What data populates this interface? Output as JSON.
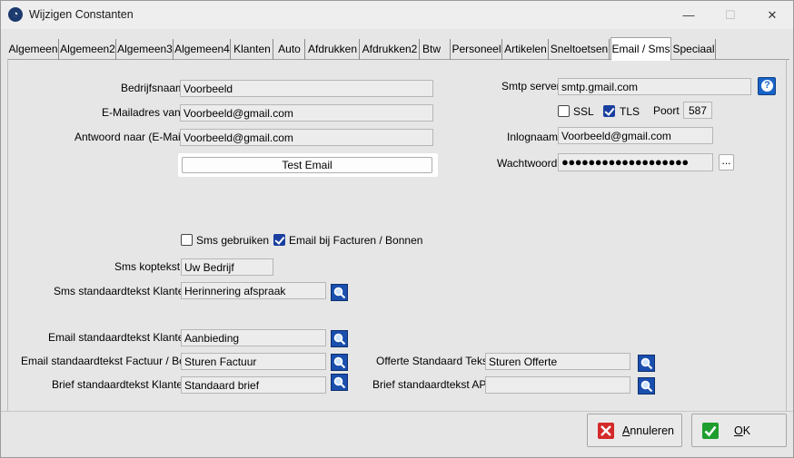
{
  "window": {
    "title": "Wijzigen Constanten",
    "minimize": "—",
    "maximize": "☐",
    "close": "✕"
  },
  "tabs": [
    {
      "label": "Algemeen",
      "active": false
    },
    {
      "label": "Algemeen2",
      "active": false
    },
    {
      "label": "Algemeen3",
      "active": false
    },
    {
      "label": "Algemeen4",
      "active": false
    },
    {
      "label": "Klanten",
      "active": false
    },
    {
      "label": "Auto",
      "active": false
    },
    {
      "label": "Afdrukken",
      "active": false
    },
    {
      "label": "Afdrukken2",
      "active": false
    },
    {
      "label": "Btw",
      "active": false
    },
    {
      "label": "Personeel",
      "active": false
    },
    {
      "label": "Artikelen",
      "active": false
    },
    {
      "label": "Sneltoetsen",
      "active": false
    },
    {
      "label": "Email / Sms",
      "active": true
    },
    {
      "label": "Speciaal",
      "active": false
    }
  ],
  "email": {
    "bedrijfsnaam_label": "Bedrijfsnaam",
    "bedrijfsnaam_value": "Voorbeeld",
    "emailadres_label": "E-Mailadres van",
    "emailadres_value": "Voorbeeld@gmail.com",
    "antwoord_label": "Antwoord naar (E-Mail)",
    "antwoord_value": "Voorbeeld@gmail.com",
    "test_button": "Test Email"
  },
  "smtp": {
    "server_label": "Smtp server",
    "server_value": "smtp.gmail.com",
    "help_icon": "question-icon",
    "ssl_label": "SSL",
    "ssl_checked": false,
    "tls_label": "TLS",
    "tls_checked": true,
    "poort_label": "Poort",
    "poort_value": "587",
    "inlognaam_label": "Inlognaam",
    "inlognaam_value": "Voorbeeld@gmail.com",
    "wachtwoord_label": "Wachtwoord",
    "wachtwoord_value": "●●●●●●●●●●●●●●●●●●●",
    "browse_label": "..."
  },
  "options": {
    "sms_gebruiken_label": "Sms gebruiken",
    "sms_gebruiken_checked": false,
    "email_facturen_label": "Email bij Facturen / Bonnen",
    "email_facturen_checked": true
  },
  "sms": {
    "koptekst_label": "Sms koptekst",
    "koptekst_value": "Uw Bedrijf",
    "standaard_label": "Sms standaardtekst Klanten",
    "standaard_value": "Herinnering afspraak"
  },
  "templates": {
    "email_klanten_label": "Email standaardtekst Klanten",
    "email_klanten_value": "Aanbieding",
    "email_factuur_label": "Email standaardtekst Factuur / Bon",
    "email_factuur_value": "Sturen Factuur",
    "brief_klanten_label": "Brief standaardtekst Klanten",
    "brief_klanten_value": "Standaard brief",
    "offerte_label": "Offerte Standaard Tekst",
    "offerte_value": "Sturen Offerte",
    "brief_apk_label": "Brief standaardtekst APK",
    "brief_apk_value": ""
  },
  "footer": {
    "cancel_pre": "",
    "cancel_u": "A",
    "cancel_post": "nnuleren",
    "ok_pre": "",
    "ok_u": "O",
    "ok_post": "K"
  },
  "colors": {
    "accent": "#1a4fae",
    "cancel_icon": "#d42a2a",
    "ok_icon": "#1e9e2e"
  }
}
